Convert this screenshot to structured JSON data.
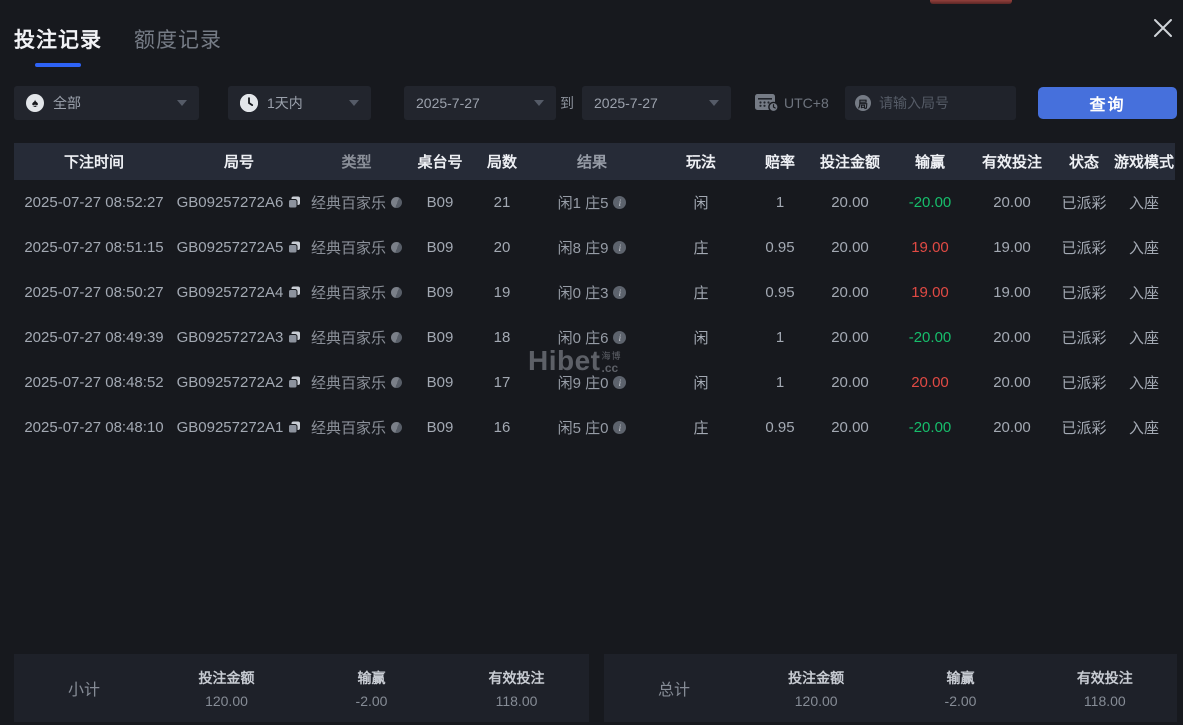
{
  "window": {
    "title_close": "close"
  },
  "tabs": {
    "bet_records": "投注记录",
    "quota_records": "额度记录"
  },
  "filters": {
    "game_type": "全部",
    "time_range": "1天内",
    "date_from": "2025-7-27",
    "to_label": "到",
    "date_to": "2025-7-27",
    "timezone": "UTC+8",
    "round_placeholder": "请输入局号",
    "search_button": "查询"
  },
  "icons": {
    "spade": "♠",
    "info": "i",
    "round_badge": "局"
  },
  "table": {
    "columns": [
      "下注时间",
      "局号",
      "类型",
      "桌台号",
      "局数",
      "结果",
      "玩法",
      "赔率",
      "投注金额",
      "输赢",
      "有效投注",
      "状态",
      "游戏模式"
    ],
    "rows": [
      {
        "time": "2025-07-27 08:52:27",
        "round_id": "GB09257272A6",
        "game_type": "经典百家乐",
        "table_no": "B09",
        "round_no": "21",
        "result": "闲1 庄5",
        "play": "闲",
        "odds": "1",
        "bet_amount": "20.00",
        "win_loss": "-20.00",
        "valid_bet": "20.00",
        "status": "已派彩",
        "mode": "入座"
      },
      {
        "time": "2025-07-27 08:51:15",
        "round_id": "GB09257272A5",
        "game_type": "经典百家乐",
        "table_no": "B09",
        "round_no": "20",
        "result": "闲8 庄9",
        "play": "庄",
        "odds": "0.95",
        "bet_amount": "20.00",
        "win_loss": "19.00",
        "valid_bet": "19.00",
        "status": "已派彩",
        "mode": "入座"
      },
      {
        "time": "2025-07-27 08:50:27",
        "round_id": "GB09257272A4",
        "game_type": "经典百家乐",
        "table_no": "B09",
        "round_no": "19",
        "result": "闲0 庄3",
        "play": "庄",
        "odds": "0.95",
        "bet_amount": "20.00",
        "win_loss": "19.00",
        "valid_bet": "19.00",
        "status": "已派彩",
        "mode": "入座"
      },
      {
        "time": "2025-07-27 08:49:39",
        "round_id": "GB09257272A3",
        "game_type": "经典百家乐",
        "table_no": "B09",
        "round_no": "18",
        "result": "闲0 庄6",
        "play": "闲",
        "odds": "1",
        "bet_amount": "20.00",
        "win_loss": "-20.00",
        "valid_bet": "20.00",
        "status": "已派彩",
        "mode": "入座"
      },
      {
        "time": "2025-07-27 08:48:52",
        "round_id": "GB09257272A2",
        "game_type": "经典百家乐",
        "table_no": "B09",
        "round_no": "17",
        "result": "闲9 庄0",
        "play": "闲",
        "odds": "1",
        "bet_amount": "20.00",
        "win_loss": "20.00",
        "valid_bet": "20.00",
        "status": "已派彩",
        "mode": "入座"
      },
      {
        "time": "2025-07-27 08:48:10",
        "round_id": "GB09257272A1",
        "game_type": "经典百家乐",
        "table_no": "B09",
        "round_no": "16",
        "result": "闲5 庄0",
        "play": "庄",
        "odds": "0.95",
        "bet_amount": "20.00",
        "win_loss": "-20.00",
        "valid_bet": "20.00",
        "status": "已派彩",
        "mode": "入座"
      }
    ]
  },
  "watermark": {
    "brand": "Hibet",
    "cn": "海博",
    "suffix": ".cc"
  },
  "summary": {
    "subtotal_label": "小计",
    "total_label": "总计",
    "bet_label": "投注金额",
    "win_label": "输赢",
    "valid_label": "有效投注",
    "subtotal": {
      "bet": "120.00",
      "win": "-2.00",
      "valid": "118.00"
    },
    "total": {
      "bet": "120.00",
      "win": "-2.00",
      "valid": "118.00"
    }
  },
  "colors": {
    "accent_blue": "#4670dc",
    "tab_underline": "#2e63f6",
    "win_positive_red": "#e14a44",
    "win_negative_green": "#17bd6b",
    "header_bg": "#262b37",
    "page_bg": "#17191e"
  }
}
